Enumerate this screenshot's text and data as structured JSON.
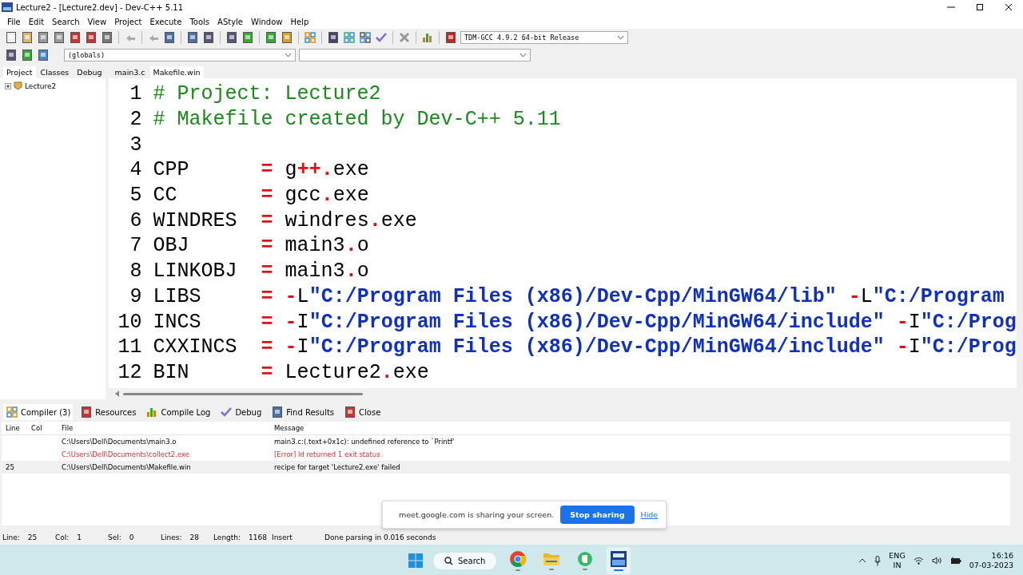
{
  "window": {
    "title": "Lecture2 - [Lecture2.dev] - Dev-C++ 5.11"
  },
  "menu": [
    "File",
    "Edit",
    "Search",
    "View",
    "Project",
    "Execute",
    "Tools",
    "AStyle",
    "Window",
    "Help"
  ],
  "toolbar": {
    "compiler": "TDM-GCC 4.9.2 64-bit Release"
  },
  "toolbar2": {
    "scope": "(globals)"
  },
  "side_tabs": [
    {
      "label": "Project",
      "selected": true
    },
    {
      "label": "Classes",
      "selected": false
    },
    {
      "label": "Debug",
      "selected": false
    }
  ],
  "tree": [
    {
      "label": "Lecture2",
      "expanded": false
    }
  ],
  "file_tabs": [
    {
      "label": "main3.c",
      "selected": false
    },
    {
      "label": "Makefile.win",
      "selected": true
    }
  ],
  "editor": {
    "lines": [
      {
        "number": "1",
        "segments": [
          {
            "kind": "comment",
            "text": "# Project: Lecture2"
          }
        ]
      },
      {
        "number": "2",
        "segments": [
          {
            "kind": "comment",
            "text": "# Makefile created by Dev-C++ 5.11"
          }
        ]
      },
      {
        "number": "3"
      },
      {
        "number": "4",
        "segments": [
          {
            "kind": "plain",
            "text": "CPP      "
          },
          {
            "kind": "op",
            "text": "="
          },
          {
            "kind": "plain",
            "text": " g"
          },
          {
            "kind": "op",
            "text": "++."
          },
          {
            "kind": "plain",
            "text": "exe"
          }
        ]
      },
      {
        "number": "5",
        "segments": [
          {
            "kind": "plain",
            "text": "CC       "
          },
          {
            "kind": "op",
            "text": "="
          },
          {
            "kind": "plain",
            "text": " gcc"
          },
          {
            "kind": "op",
            "text": "."
          },
          {
            "kind": "plain",
            "text": "exe"
          }
        ]
      },
      {
        "number": "6",
        "segments": [
          {
            "kind": "plain",
            "text": "WINDRES  "
          },
          {
            "kind": "op",
            "text": "="
          },
          {
            "kind": "plain",
            "text": " windres"
          },
          {
            "kind": "op",
            "text": "."
          },
          {
            "kind": "plain",
            "text": "exe"
          }
        ]
      },
      {
        "number": "7",
        "segments": [
          {
            "kind": "plain",
            "text": "OBJ      "
          },
          {
            "kind": "op",
            "text": "="
          },
          {
            "kind": "plain",
            "text": " main3"
          },
          {
            "kind": "op",
            "text": "."
          },
          {
            "kind": "plain",
            "text": "o"
          }
        ]
      },
      {
        "number": "8",
        "segments": [
          {
            "kind": "plain",
            "text": "LINKOBJ  "
          },
          {
            "kind": "op",
            "text": "="
          },
          {
            "kind": "plain",
            "text": " main3"
          },
          {
            "kind": "op",
            "text": "."
          },
          {
            "kind": "plain",
            "text": "o"
          }
        ]
      },
      {
        "number": "9",
        "segments": [
          {
            "kind": "plain",
            "text": "LIBS     "
          },
          {
            "kind": "op",
            "text": "= -"
          },
          {
            "kind": "plain",
            "text": "L"
          },
          {
            "kind": "string",
            "text": "\"C:/Program Files (x86)/Dev-Cpp/MinGW64/lib\" "
          },
          {
            "kind": "op",
            "text": "-"
          },
          {
            "kind": "plain",
            "text": "L"
          },
          {
            "kind": "string",
            "text": "\"C:/Program"
          }
        ]
      },
      {
        "number": "10",
        "segments": [
          {
            "kind": "plain",
            "text": "INCS     "
          },
          {
            "kind": "op",
            "text": "= -"
          },
          {
            "kind": "plain",
            "text": "I"
          },
          {
            "kind": "string",
            "text": "\"C:/Program Files (x86)/Dev-Cpp/MinGW64/include\" "
          },
          {
            "kind": "op",
            "text": "-"
          },
          {
            "kind": "plain",
            "text": "I"
          },
          {
            "kind": "string",
            "text": "\"C:/Prog"
          }
        ]
      },
      {
        "number": "11",
        "segments": [
          {
            "kind": "plain",
            "text": "CXXINCS  "
          },
          {
            "kind": "op",
            "text": "= -"
          },
          {
            "kind": "plain",
            "text": "I"
          },
          {
            "kind": "string",
            "text": "\"C:/Program Files (x86)/Dev-Cpp/MinGW64/include\" "
          },
          {
            "kind": "op",
            "text": "-"
          },
          {
            "kind": "plain",
            "text": "I"
          },
          {
            "kind": "string",
            "text": "\"C:/Prog"
          }
        ]
      },
      {
        "number": "12",
        "segments": [
          {
            "kind": "plain",
            "text": "BIN      "
          },
          {
            "kind": "op",
            "text": "="
          },
          {
            "kind": "plain",
            "text": " Lecture2"
          },
          {
            "kind": "op",
            "text": "."
          },
          {
            "kind": "plain",
            "text": "exe"
          }
        ]
      }
    ]
  },
  "bottom_tabs": [
    {
      "label": "Compiler (3)",
      "selected": true
    },
    {
      "label": "Resources",
      "selected": false
    },
    {
      "label": "Compile Log",
      "selected": false
    },
    {
      "label": "Debug",
      "selected": false
    },
    {
      "label": "Find Results",
      "selected": false
    },
    {
      "label": "Close",
      "selected": false
    }
  ],
  "messages": {
    "columns": [
      "Line",
      "Col",
      "File",
      "Message"
    ],
    "rows": [
      {
        "line": "",
        "col": "",
        "file": "C:\\Users\\Dell\\Documents\\main3.o",
        "message": "main3.c:(.text+0x1c): undefined reference to `Printf'",
        "error": false,
        "selected": false
      },
      {
        "line": "",
        "col": "",
        "file": "C:\\Users\\Dell\\Documents\\collect2.exe",
        "message": "[Error] ld returned 1 exit status",
        "error": true,
        "selected": false
      },
      {
        "line": "25",
        "col": "",
        "file": "C:\\Users\\Dell\\Documents\\Makefile.win",
        "message": "recipe for target 'Lecture2.exe' failed",
        "error": false,
        "selected": true
      }
    ]
  },
  "share_bar": {
    "text": "meet.google.com is sharing your screen.",
    "stop": "Stop sharing",
    "hide": "Hide"
  },
  "status_bar": [
    {
      "label": "Line:",
      "value": "25"
    },
    {
      "label": "Col:",
      "value": "1"
    },
    {
      "label": "Sel:",
      "value": "0"
    },
    {
      "label": "Lines:",
      "value": "28"
    },
    {
      "label": "Length:",
      "value": "1168"
    },
    {
      "value": "Insert"
    },
    {
      "value": "Done parsing in 0.016 seconds"
    }
  ],
  "taskbar": {
    "search": "Search",
    "apps": [
      {
        "kind": "chrome",
        "selected": false
      },
      {
        "kind": "folder",
        "selected": false
      },
      {
        "kind": "evernote",
        "selected": false
      },
      {
        "kind": "devcpp",
        "selected": true
      }
    ],
    "lang": "ENG",
    "region": "IN",
    "time": "16:16",
    "date": "07-03-2023"
  }
}
